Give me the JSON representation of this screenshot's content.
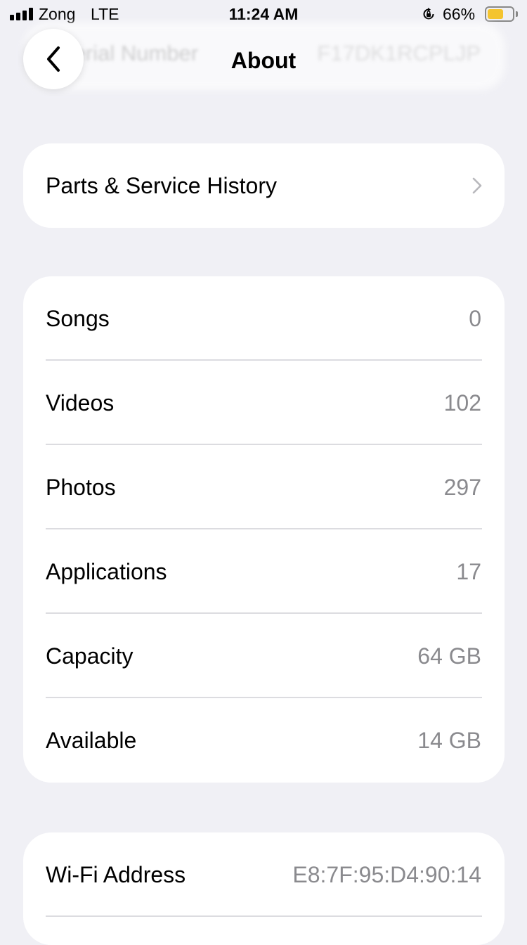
{
  "status_bar": {
    "carrier": "Zong",
    "network": "LTE",
    "time": "11:24 AM",
    "battery_percent": "66%",
    "battery_level": 0.66,
    "battery_color": "#f4c430"
  },
  "nav": {
    "title": "About",
    "back_icon": "chevron-left-icon",
    "behind_row": {
      "label": "Serial Number",
      "value": "F17DK1RCPLJP"
    }
  },
  "parts_service": {
    "label": "Parts & Service History",
    "icon": "chevron-right-icon"
  },
  "stats": [
    {
      "label": "Songs",
      "value": "0"
    },
    {
      "label": "Videos",
      "value": "102"
    },
    {
      "label": "Photos",
      "value": "297"
    },
    {
      "label": "Applications",
      "value": "17"
    },
    {
      "label": "Capacity",
      "value": "64 GB"
    },
    {
      "label": "Available",
      "value": "14 GB"
    }
  ],
  "network_info": [
    {
      "label": "Wi-Fi Address",
      "value": "E8:7F:95:D4:90:14"
    }
  ]
}
